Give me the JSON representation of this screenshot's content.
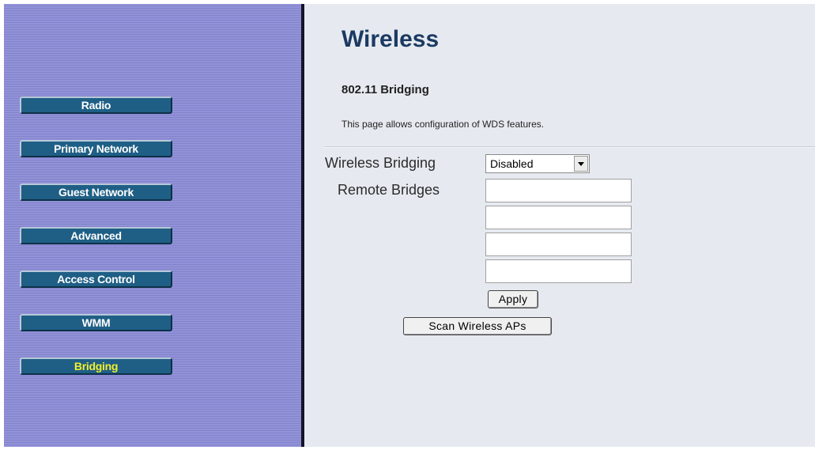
{
  "sidebar": {
    "items": [
      {
        "label": "Radio"
      },
      {
        "label": "Primary Network"
      },
      {
        "label": "Guest Network"
      },
      {
        "label": "Advanced"
      },
      {
        "label": "Access Control"
      },
      {
        "label": "WMM"
      },
      {
        "label": "Bridging",
        "active": true
      }
    ]
  },
  "main": {
    "title": "Wireless",
    "section_title": "802.11 Bridging",
    "description": "This page allows configuration of WDS features.",
    "wireless_bridging": {
      "label": "Wireless Bridging",
      "value": "Disabled"
    },
    "remote_bridges": {
      "label": "Remote Bridges",
      "values": [
        "",
        "",
        "",
        ""
      ]
    },
    "apply_label": "Apply",
    "scan_label": "Scan Wireless APs"
  },
  "colors": {
    "sidebar_bg": "#8d8dd4",
    "nav_button": "#1f5f86",
    "active_text": "#f2ef2c",
    "content_bg": "#e6eaf0",
    "title_color": "#1b3a62"
  }
}
